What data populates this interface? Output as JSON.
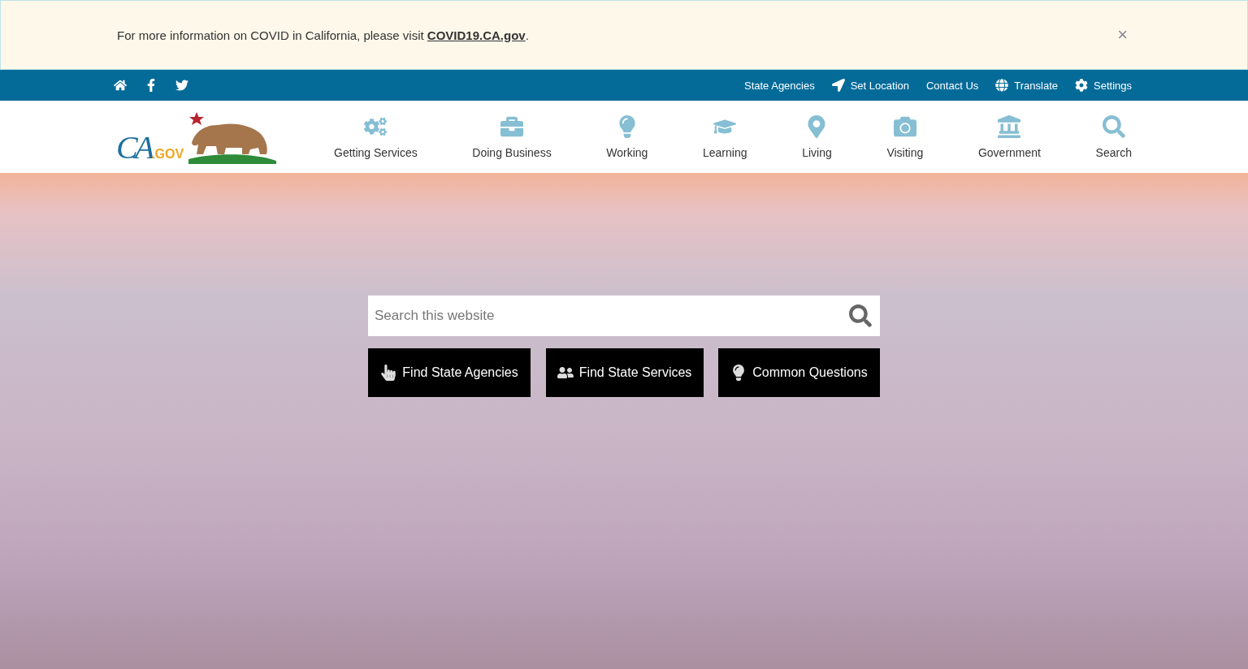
{
  "alert": {
    "text": "For more information on COVID in California, please visit",
    "link": "COVID19.CA.gov",
    "end": ".",
    "close": "×"
  },
  "utility_bar": {
    "social": [
      {
        "kind": "home"
      },
      {
        "kind": "facebook"
      },
      {
        "kind": "twitter"
      }
    ],
    "links": [
      {
        "label": "State Agencies",
        "kind": "plain"
      },
      {
        "label": "Set Location",
        "kind": "location"
      },
      {
        "label": "Contact Us",
        "kind": "plain"
      },
      {
        "label": "Translate",
        "kind": "globe"
      },
      {
        "label": "Settings",
        "kind": "gear"
      }
    ]
  },
  "logo": {
    "mark": "CA",
    "suffix": ".GOV"
  },
  "nav": [
    {
      "label": "Getting Services",
      "kind": "gears"
    },
    {
      "label": "Doing Business",
      "kind": "briefcase"
    },
    {
      "label": "Working",
      "kind": "bulb"
    },
    {
      "label": "Learning",
      "kind": "cap"
    },
    {
      "label": "Living",
      "kind": "state"
    },
    {
      "label": "Visiting",
      "kind": "camera"
    },
    {
      "label": "Government",
      "kind": "capitol"
    },
    {
      "label": "Search",
      "kind": "search"
    }
  ],
  "hero": {
    "search": {
      "placeholder": "Search this website"
    },
    "buttons": [
      {
        "label": "Find State Agencies",
        "kind": "pointer"
      },
      {
        "label": "Find State Services",
        "kind": "people"
      },
      {
        "label": "Common Questions",
        "kind": "bulb"
      }
    ]
  }
}
